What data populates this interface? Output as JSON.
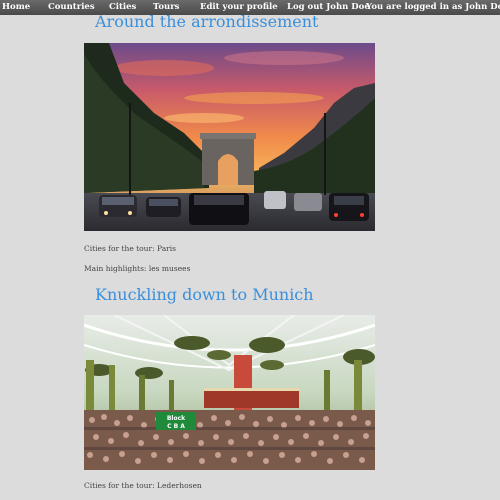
{
  "nav": {
    "items": [
      "Home",
      "Countries",
      "Cities",
      "Tours",
      "Edit your profile",
      "Log out John Doe",
      "You are logged in as John Doe"
    ]
  },
  "tours": [
    {
      "title": "Around the arrondissement",
      "image_alt": "Arc de Triomphe at sunset",
      "cities_label": "Cities for the tour: Paris",
      "highlights_label": "Main highlights: les musees"
    },
    {
      "title": "Knuckling down to Munich",
      "image_alt": "Oktoberfest beer tent",
      "sign_text": "Block C B A",
      "cities_label": "Cities for the tour: Lederhosen"
    }
  ],
  "colors": {
    "nav_bg": "#555555",
    "page_bg": "#dcdcdc",
    "title": "#3a8fdc"
  }
}
